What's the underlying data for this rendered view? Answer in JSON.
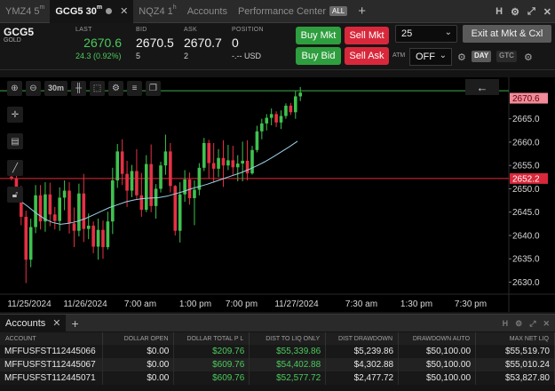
{
  "tabs": [
    {
      "label": "YMZ4 5",
      "sup": "m",
      "active": false
    },
    {
      "label": "GCG5 30",
      "sup": "m",
      "active": true
    },
    {
      "label": "NQZ4 1",
      "sup": "h",
      "active": false
    },
    {
      "label": "Accounts",
      "sup": "",
      "active": false
    },
    {
      "label": "Performance Center",
      "sup": "",
      "active": false
    }
  ],
  "all_badge": "ALL",
  "window_controls": [
    "H",
    "⚙",
    "⤢",
    "✕"
  ],
  "quote": {
    "symbol": "GCG5",
    "description": "GOLD",
    "last_label": "LAST",
    "last": "2670.6",
    "change": "24.3 (0.92%)",
    "bid_label": "BID",
    "bid": "2670.5",
    "bid_size": "5",
    "ask_label": "ASK",
    "ask": "2670.7",
    "ask_size": "2",
    "position_label": "POSITION",
    "position": "0",
    "position_pnl": "-.-- USD"
  },
  "order_buttons": {
    "buy_mkt": "Buy Mkt",
    "sell_mkt": "Sell Mkt",
    "buy_bid": "Buy Bid",
    "sell_ask": "Sell Ask",
    "quantity": "25",
    "exit": "Exit at Mkt & Cxl",
    "atm_label": "ATM",
    "atm_value": "OFF",
    "day_chip": "DAY",
    "gtc_chip": "GTC"
  },
  "chart_toolbar": {
    "period": "30m"
  },
  "chart_data": {
    "type": "candlestick",
    "y_ticks": [
      "2665.0",
      "2660.0",
      "2655.0",
      "2650.0",
      "2645.0",
      "2640.0",
      "2635.0",
      "2630.0"
    ],
    "x_ticks": [
      "11/25/2024",
      "11/26/2024",
      "7:00 am",
      "1:00 pm",
      "7:00 pm",
      "11/27/2024",
      "7:30 am",
      "1:30 pm",
      "7:30 pm"
    ],
    "last_price_label": "2670.6",
    "red_line_label": "2652.2",
    "red_line_value": 2652.2,
    "green_line_value": 2671.0,
    "ylim": [
      2628.0,
      2673.5
    ],
    "colors": {
      "up": "#3fc24f",
      "down": "#e53144",
      "ma": "#9cd3e6",
      "red_line": "#e02a3b",
      "green_line": "#3fae49"
    },
    "candles": [
      [
        2652.6,
        2653.5,
        2651.8,
        2652.2
      ],
      [
        2652.2,
        2653.0,
        2648.5,
        2649.8
      ],
      [
        2649.8,
        2650.6,
        2642.2,
        2644.0
      ],
      [
        2644.0,
        2645.3,
        2629.8,
        2634.8
      ],
      [
        2634.8,
        2643.6,
        2633.2,
        2641.8
      ],
      [
        2641.8,
        2650.8,
        2640.5,
        2648.6
      ],
      [
        2648.6,
        2650.8,
        2641.3,
        2643.0
      ],
      [
        2643.0,
        2651.4,
        2640.8,
        2648.8
      ],
      [
        2648.8,
        2651.3,
        2642.0,
        2644.5
      ],
      [
        2644.5,
        2646.1,
        2641.3,
        2643.1
      ],
      [
        2643.1,
        2650.3,
        2641.0,
        2648.1
      ],
      [
        2648.1,
        2651.8,
        2645.4,
        2649.6
      ],
      [
        2649.6,
        2651.4,
        2640.4,
        2642.6
      ],
      [
        2642.6,
        2646.0,
        2637.5,
        2641.0
      ],
      [
        2641.0,
        2651.1,
        2639.8,
        2649.0
      ],
      [
        2649.0,
        2653.2,
        2638.6,
        2641.4
      ],
      [
        2641.4,
        2644.7,
        2639.2,
        2642.1
      ],
      [
        2642.1,
        2643.0,
        2636.2,
        2637.6
      ],
      [
        2637.6,
        2643.6,
        2634.8,
        2641.2
      ],
      [
        2641.2,
        2643.2,
        2635.0,
        2637.5
      ],
      [
        2637.5,
        2645.1,
        2637.0,
        2643.0
      ],
      [
        2643.0,
        2654.5,
        2640.3,
        2651.8
      ],
      [
        2651.8,
        2659.6,
        2650.2,
        2658.0
      ],
      [
        2658.0,
        2660.6,
        2650.8,
        2653.2
      ],
      [
        2653.2,
        2656.0,
        2646.1,
        2649.6
      ],
      [
        2649.6,
        2655.1,
        2648.2,
        2653.8
      ],
      [
        2653.8,
        2658.5,
        2647.8,
        2648.6
      ],
      [
        2648.6,
        2653.4,
        2644.0,
        2645.5
      ],
      [
        2645.5,
        2657.2,
        2645.0,
        2655.3
      ],
      [
        2655.3,
        2659.5,
        2645.0,
        2646.3
      ],
      [
        2646.3,
        2651.0,
        2643.6,
        2650.0
      ],
      [
        2650.0,
        2655.8,
        2649.2,
        2655.0
      ],
      [
        2655.0,
        2661.6,
        2653.0,
        2658.0
      ],
      [
        2658.0,
        2659.8,
        2649.2,
        2650.6
      ],
      [
        2650.6,
        2650.8,
        2640.0,
        2641.0
      ],
      [
        2641.0,
        2651.4,
        2638.5,
        2648.8
      ],
      [
        2648.8,
        2654.0,
        2647.2,
        2652.0
      ],
      [
        2652.0,
        2653.5,
        2646.6,
        2648.0
      ],
      [
        2648.0,
        2651.8,
        2642.2,
        2649.8
      ],
      [
        2649.8,
        2655.5,
        2648.6,
        2654.5
      ],
      [
        2654.5,
        2660.9,
        2653.8,
        2659.8
      ],
      [
        2659.8,
        2660.5,
        2652.2,
        2655.5
      ],
      [
        2655.5,
        2659.8,
        2651.3,
        2654.3
      ],
      [
        2654.3,
        2658.5,
        2652.5,
        2656.6
      ],
      [
        2656.6,
        2660.4,
        2650.4,
        2655.0
      ],
      [
        2655.0,
        2659.4,
        2654.0,
        2656.1
      ],
      [
        2656.1,
        2659.2,
        2652.8,
        2654.6
      ],
      [
        2654.6,
        2657.2,
        2651.6,
        2655.4
      ],
      [
        2655.4,
        2660.1,
        2651.6,
        2656.0
      ],
      [
        2656.0,
        2660.4,
        2651.8,
        2653.3
      ],
      [
        2653.3,
        2659.2,
        2653.0,
        2658.3
      ],
      [
        2658.3,
        2663.5,
        2657.8,
        2662.3
      ],
      [
        2662.3,
        2665.0,
        2660.6,
        2664.0
      ],
      [
        2664.0,
        2666.0,
        2662.5,
        2665.2
      ],
      [
        2665.2,
        2667.2,
        2663.6,
        2666.0
      ],
      [
        2666.0,
        2666.6,
        2663.2,
        2664.2
      ],
      [
        2664.2,
        2666.8,
        2662.8,
        2665.6
      ],
      [
        2665.6,
        2668.3,
        2665.0,
        2667.8
      ],
      [
        2667.8,
        2668.4,
        2665.8,
        2666.4
      ],
      [
        2666.4,
        2670.9,
        2665.0,
        2669.8
      ],
      [
        2669.8,
        2671.8,
        2668.8,
        2670.6
      ]
    ],
    "ma_values": [
      2648.8,
      2647.5,
      2646.2,
      2644.8,
      2643.6,
      2642.8,
      2642.4,
      2642.6,
      2643.0,
      2643.6,
      2644.4,
      2645.2,
      2646.0,
      2646.6,
      2647.2,
      2647.6,
      2647.9,
      2648.0,
      2648.1,
      2648.4,
      2648.9,
      2649.4,
      2650.0,
      2650.5,
      2651.0,
      2651.6,
      2652.2,
      2652.8,
      2653.4,
      2654.1,
      2654.9,
      2655.8,
      2656.8,
      2657.9,
      2659.0,
      2660.2
    ]
  },
  "accounts": {
    "tab_label": "Accounts",
    "columns": [
      "ACCOUNT",
      "DOLLAR OPEN",
      "DOLLAR TOTAL P L",
      "DIST TO LIQ ONLY",
      "DIST DRAWDOWN",
      "DRAWDOWN AUTO",
      "MAX NET LIQ"
    ],
    "rows": [
      [
        "MFFUSFST112445066",
        "$0.00",
        "$209.76",
        "$55,339.86",
        "$5,239.86",
        "$50,100.00",
        "$55,519.70"
      ],
      [
        "MFFUSFST112445067",
        "$0.00",
        "$609.76",
        "$54,402.88",
        "$4,302.88",
        "$50,100.00",
        "$55,010.24"
      ],
      [
        "MFFUSFST112445071",
        "$0.00",
        "$609.76",
        "$52,577.72",
        "$2,477.72",
        "$50,100.00",
        "$53,827.80"
      ]
    ]
  }
}
